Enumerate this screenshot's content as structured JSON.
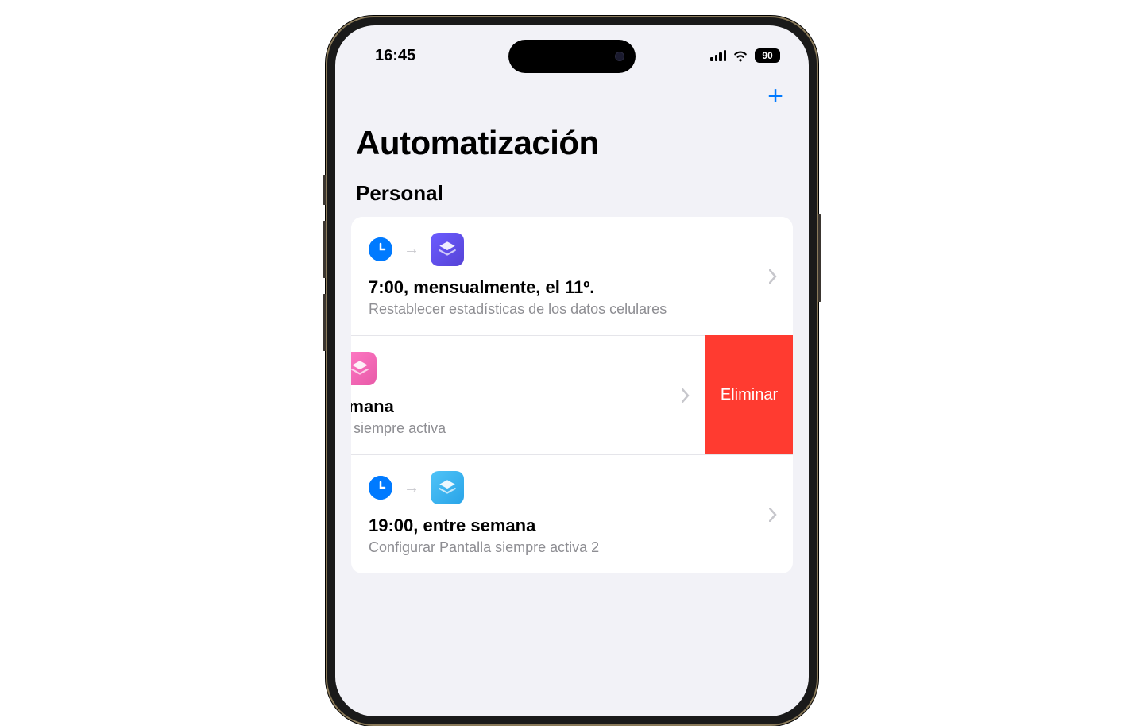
{
  "statusBar": {
    "time": "16:45",
    "battery": "90"
  },
  "navBar": {
    "addIcon": "+"
  },
  "page": {
    "title": "Automatización"
  },
  "section": {
    "header": "Personal"
  },
  "automations": [
    {
      "title": "7:00, mensualmente, el 11º.",
      "subtitle": "Restablecer estadísticas de los datos celulares",
      "triggerIcon": "clock",
      "actionIcon": "shortcuts-purple",
      "swiped": false
    },
    {
      "title": "entre semana",
      "subtitle": "ar Pantalla siempre activa",
      "triggerIcon": null,
      "actionIcon": "shortcuts-pink",
      "swiped": true
    },
    {
      "title": "19:00, entre semana",
      "subtitle": "Configurar Pantalla siempre activa 2",
      "triggerIcon": "clock",
      "actionIcon": "shortcuts-blue",
      "swiped": false
    }
  ],
  "deleteAction": {
    "label": "Eliminar"
  }
}
